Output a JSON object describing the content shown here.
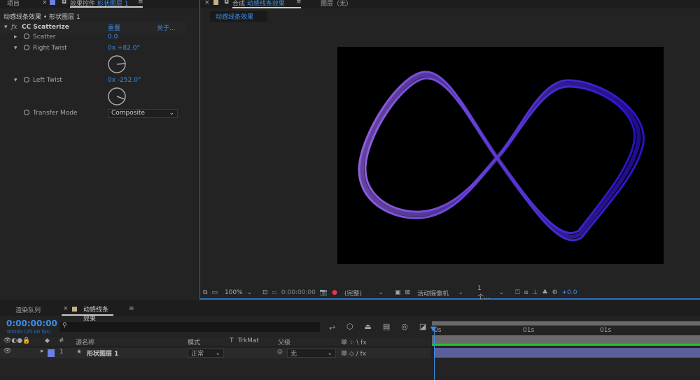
{
  "left_panel": {
    "tab_project": "项目",
    "tab_effects": "效果控件",
    "tab_effects_layer": "形状图层 1",
    "breadcrumb": "动感线条效果 • 形状图层 1",
    "effect": {
      "name": "CC Scatterize",
      "reset": "重置",
      "about": "关于...",
      "params": [
        {
          "label": "Scatter",
          "value": "0.0"
        },
        {
          "label": "Right Twist",
          "value": "0x +82.0°",
          "dial_deg": 82
        },
        {
          "label": "Left Twist",
          "value": "0x -252.0°",
          "dial_deg": -252
        },
        {
          "label": "Transfer Mode",
          "value": "Composite"
        }
      ]
    }
  },
  "comp_panel": {
    "tab_label": "合成",
    "tab_comp": "动感线条效果",
    "tab_layer": "图层（无）",
    "subtab": "动感线条效果",
    "toolbar": {
      "zoom": "100%",
      "timecode": "0:00:00:00",
      "resolution": "(完整)",
      "camera": "活动摄像机",
      "views": "1 个...",
      "exposure": "+0.0"
    },
    "colors": {
      "stroke_left": "#8e5fe0",
      "stroke_right": "#2a12c8"
    }
  },
  "timeline": {
    "tab_render": "渲染队列",
    "tab_comp": "动感线条效果",
    "timecode": "0:00:00:00",
    "frame_info": "00000 (25.00 fps)",
    "columns": {
      "num": "#",
      "source": "源名称",
      "mode": "模式",
      "t": "T",
      "trkmat": "TrkMat",
      "parent": "父级",
      "switches": "单 ⁘ \\ fx"
    },
    "layers": [
      {
        "num": "1",
        "name": "形状图层 1",
        "mode": "正常",
        "parent": "无",
        "color": "#6b7fe6"
      }
    ],
    "ruler": [
      "0s",
      "01s",
      "01s"
    ]
  }
}
